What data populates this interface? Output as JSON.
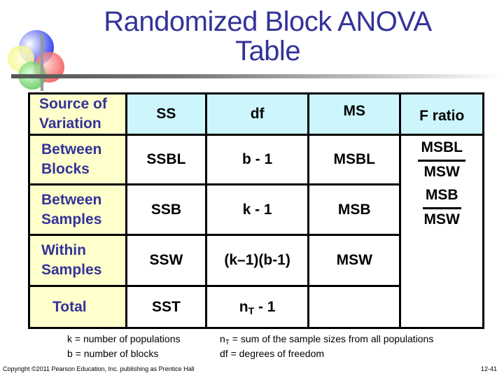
{
  "slide": {
    "title_line1": "Randomized Block ANOVA",
    "title_line2": "Table"
  },
  "table": {
    "headers": {
      "source": "Source of Variation",
      "ss": "SS",
      "df": "df",
      "ms": "MS",
      "f": "F ratio"
    },
    "rows": [
      {
        "source_l1": "Between",
        "source_l2": "Blocks",
        "ss": "SSBL",
        "df": "b - 1",
        "ms": "MSBL",
        "f_num": "MSBL",
        "f_den": "MSW"
      },
      {
        "source_l1": "Between",
        "source_l2": "Samples",
        "ss": "SSB",
        "df": "k - 1",
        "ms": "MSB",
        "f_num": "MSB",
        "f_den": "MSW"
      },
      {
        "source_l1": "Within",
        "source_l2": "Samples",
        "ss": "SSW",
        "df": "(k–1)(b-1)",
        "ms": "MSW"
      },
      {
        "source_l1": "Total",
        "ss": "SST",
        "df_base": "n",
        "df_sub": "T",
        "df_rest": " - 1"
      }
    ]
  },
  "notes": {
    "k": "k = number of populations",
    "b": "b = number of blocks",
    "nt_base": "n",
    "nt_sub": "T",
    "nt_rest": " = sum of the sample sizes from all populations",
    "df": "df = degrees of freedom"
  },
  "footer": {
    "copyright": "Copyright ©2011 Pearson Education, Inc. publishing as Prentice Hall",
    "page": "12-41"
  },
  "colors": {
    "title": "#333399",
    "header_bg": "#ccf6fc",
    "source_bg": "#ffffcc"
  }
}
